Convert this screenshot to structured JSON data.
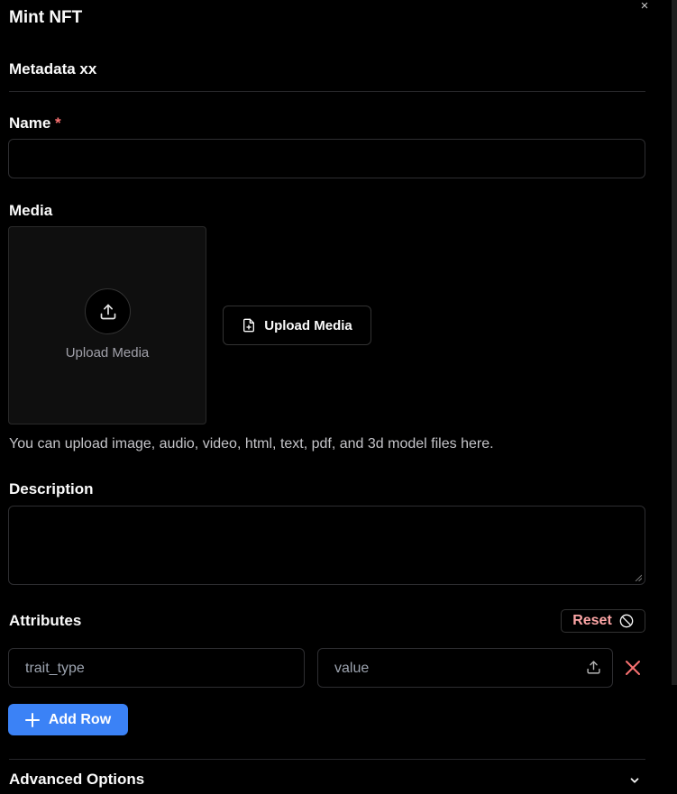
{
  "dialog": {
    "title": "Mint NFT",
    "close_icon": "×"
  },
  "metadata": {
    "section_title": "Metadata xx"
  },
  "name": {
    "label": "Name",
    "required_mark": "*",
    "value": "",
    "placeholder": ""
  },
  "media": {
    "label": "Media",
    "dropzone_text": "Upload Media",
    "upload_button_label": "Upload Media",
    "help_text": "You can upload image, audio, video, html, text, pdf, and 3d model files here."
  },
  "description": {
    "label": "Description",
    "value": ""
  },
  "attributes": {
    "label": "Attributes",
    "reset_label": "Reset",
    "rows": [
      {
        "trait_type_placeholder": "trait_type",
        "value_placeholder": "value"
      }
    ],
    "add_row_label": "Add Row"
  },
  "advanced": {
    "label": "Advanced Options"
  },
  "colors": {
    "background": "#000000",
    "accent": "#3b82f6",
    "danger": "#f87171",
    "reset_text": "#fca5a5"
  },
  "icons": [
    "close-icon",
    "upload-icon",
    "file-plus-icon",
    "ban-icon",
    "x-icon",
    "plus-icon",
    "chevron-down-icon"
  ]
}
